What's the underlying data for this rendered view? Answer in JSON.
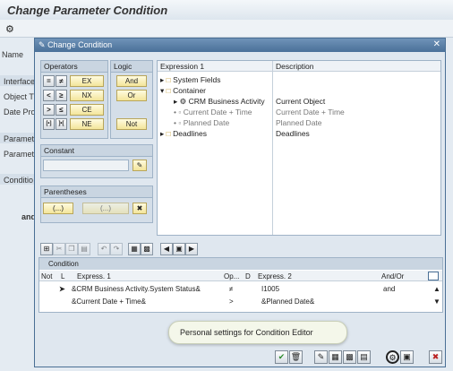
{
  "screen": {
    "title": "Change Parameter Condition",
    "bg_labels": [
      "Name",
      "Interface",
      "Object T",
      "Date Pro",
      "Paramete",
      "Paramete",
      "Conditio",
      "and"
    ]
  },
  "dialog": {
    "title": "Change Condition",
    "operators": {
      "header": "Operators",
      "symbols": [
        "=",
        "≠",
        "<",
        "≥",
        ">",
        "≤",
        "[•]",
        "]•["
      ],
      "labels": [
        "EX",
        "NX",
        "CE",
        "NE"
      ]
    },
    "logic": {
      "header": "Logic",
      "buttons": [
        "And",
        "Or",
        "Not"
      ]
    },
    "constant": {
      "header": "Constant",
      "value": ""
    },
    "parentheses": {
      "header": "Parentheses",
      "buttons": [
        "(...)",
        "(...)",
        "(...)"
      ]
    },
    "expression_tree": {
      "col1": "Expression 1",
      "col2": "Description",
      "rows": [
        {
          "label": "System Fields",
          "desc": ""
        },
        {
          "label": "Container",
          "desc": ""
        },
        {
          "label": "CRM Business Activity",
          "desc": "Current Object"
        },
        {
          "label": "Current Date + Time",
          "desc": "Current Date + Time"
        },
        {
          "label": "Planned Date",
          "desc": "Planned Date"
        },
        {
          "label": "Deadlines",
          "desc": "Deadlines"
        }
      ]
    },
    "condition": {
      "header": "Condition",
      "columns": [
        "Not",
        "L",
        "Express. 1",
        "Op...",
        "D",
        "Express. 2",
        "And/Or"
      ],
      "rows": [
        {
          "expr1": "&CRM Business Activity.System Status&",
          "op": "≠",
          "expr2": "I1005",
          "andor": "and"
        },
        {
          "expr1": "&Current Date + Time&",
          "op": ">",
          "expr2": "&Planned Date&",
          "andor": ""
        }
      ]
    },
    "tooltip": "Personal settings for Condition Editor"
  }
}
